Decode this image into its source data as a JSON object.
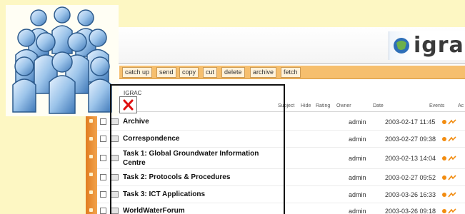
{
  "header": {
    "logo_text": "igrac"
  },
  "toolbar": {
    "buttons": [
      "catch up",
      "send",
      "copy",
      "cut",
      "delete",
      "archive",
      "fetch"
    ]
  },
  "path": "IGRAC",
  "columns": [
    "Subject",
    "Hide",
    "Rating",
    "Owner",
    "Date",
    "Events",
    "Ac"
  ],
  "rows": [
    {
      "title": "Archive",
      "owner": "admin",
      "date": "2003-02-17 11:45"
    },
    {
      "title": "Correspondence",
      "owner": "admin",
      "date": "2003-02-27 09:38"
    },
    {
      "title": "Task 1: Global Groundwater Information Centre",
      "owner": "admin",
      "date": "2003-02-13 14:04"
    },
    {
      "title": "Task 2: Protocols & Procedures",
      "owner": "admin",
      "date": "2003-02-27 09:52"
    },
    {
      "title": "Task 3: ICT Applications",
      "owner": "admin",
      "date": "2003-03-26 16:33"
    },
    {
      "title": "WorldWaterForum",
      "owner": "admin",
      "date": "2003-03-26 09:18"
    }
  ],
  "colors": {
    "background": "#fdf7c3",
    "toolbar": "#f6bf6e",
    "sidebar": "#e17d20",
    "close_icon": "#e01010"
  },
  "icons": [
    "people-group-icon",
    "close-icon",
    "folder-icon",
    "event-icon"
  ]
}
